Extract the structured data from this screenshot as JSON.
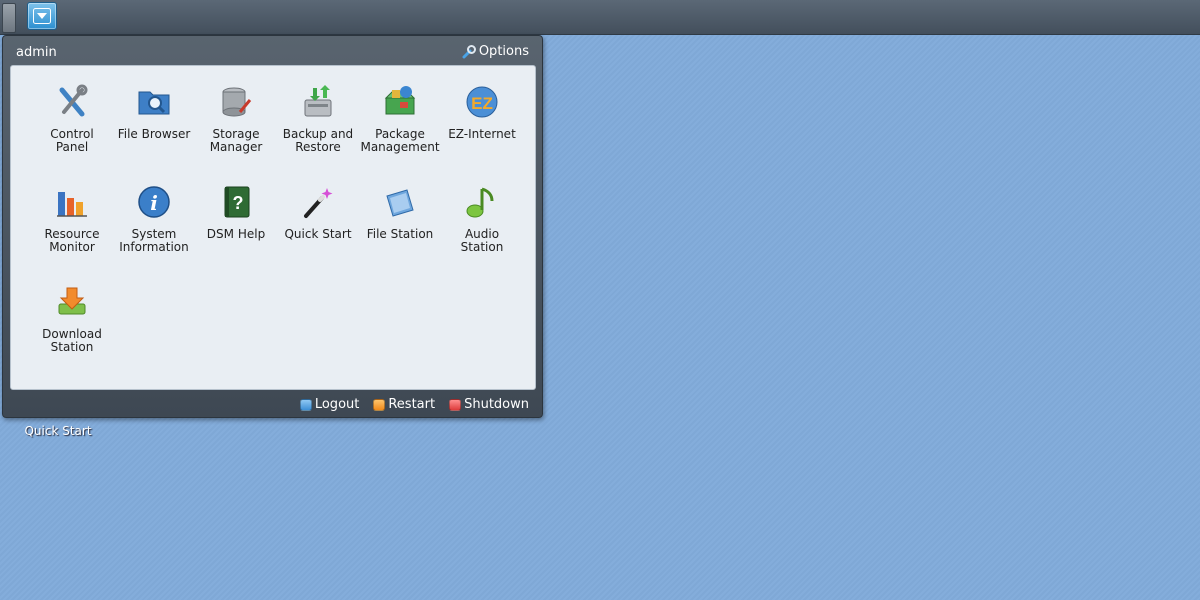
{
  "taskbar": {
    "menu_toggle_icon": "chevron-down-icon"
  },
  "desktop": {
    "shortcut_label": "Quick Start"
  },
  "menu": {
    "user": "admin",
    "options_label": "Options",
    "apps": [
      {
        "label": "Control\nPanel",
        "icon": "control-panel-icon"
      },
      {
        "label": "File Browser",
        "icon": "file-browser-icon"
      },
      {
        "label": "Storage\nManager",
        "icon": "storage-manager-icon"
      },
      {
        "label": "Backup and\nRestore",
        "icon": "backup-restore-icon"
      },
      {
        "label": "Package\nManagement",
        "icon": "package-icon"
      },
      {
        "label": "EZ-Internet",
        "icon": "ez-internet-icon"
      },
      {
        "label": "Resource\nMonitor",
        "icon": "resource-monitor-icon"
      },
      {
        "label": "System\nInformation",
        "icon": "info-icon"
      },
      {
        "label": "DSM Help",
        "icon": "help-icon"
      },
      {
        "label": "Quick Start",
        "icon": "wand-icon"
      },
      {
        "label": "File Station",
        "icon": "file-station-icon"
      },
      {
        "label": "Audio\nStation",
        "icon": "music-note-icon"
      },
      {
        "label": "Download\nStation",
        "icon": "download-icon"
      }
    ],
    "footer": {
      "logout": "Logout",
      "restart": "Restart",
      "shutdown": "Shutdown"
    }
  }
}
